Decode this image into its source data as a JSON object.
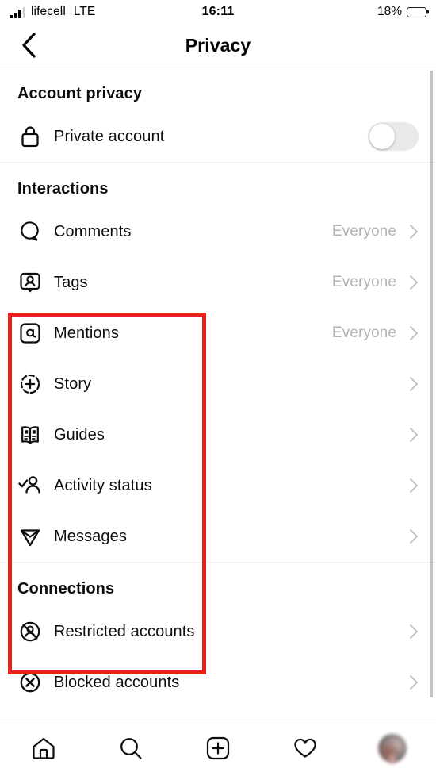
{
  "statusbar": {
    "signal_icon": "cellular-bars-icon",
    "carrier": "lifecell",
    "network": "LTE",
    "time": "16:11",
    "battery_percent": "18%",
    "battery_level": 18,
    "battery_color": "#ff2d22"
  },
  "navbar": {
    "back_icon": "chevron-left-icon",
    "title": "Privacy"
  },
  "sections": [
    {
      "title": "Account privacy",
      "rows": [
        {
          "icon": "lock-icon",
          "label": "Private account",
          "control": "toggle",
          "toggle_on": false
        }
      ]
    },
    {
      "title": "Interactions",
      "rows": [
        {
          "icon": "comment-bubble-icon",
          "label": "Comments",
          "value": "Everyone",
          "control": "chevron"
        },
        {
          "icon": "tag-person-icon",
          "label": "Tags",
          "value": "Everyone",
          "control": "chevron"
        },
        {
          "icon": "mention-at-icon",
          "label": "Mentions",
          "value": "Everyone",
          "control": "chevron"
        },
        {
          "icon": "story-plus-icon",
          "label": "Story",
          "value": "",
          "control": "chevron"
        },
        {
          "icon": "guides-book-icon",
          "label": "Guides",
          "value": "",
          "control": "chevron"
        },
        {
          "icon": "activity-status-icon",
          "label": "Activity status",
          "value": "",
          "control": "chevron"
        },
        {
          "icon": "messages-send-icon",
          "label": "Messages",
          "value": "",
          "control": "chevron"
        }
      ]
    },
    {
      "title": "Connections",
      "rows": [
        {
          "icon": "restricted-account-icon",
          "label": "Restricted accounts",
          "value": "",
          "control": "chevron"
        },
        {
          "icon": "blocked-account-icon",
          "label": "Blocked accounts",
          "value": "",
          "control": "chevron"
        }
      ]
    }
  ],
  "annotation": {
    "type": "highlight-box",
    "color": "#e8211c"
  },
  "tabbar": {
    "items": [
      {
        "icon": "home-icon",
        "label": "Home"
      },
      {
        "icon": "search-icon",
        "label": "Search"
      },
      {
        "icon": "add-post-icon",
        "label": "Create"
      },
      {
        "icon": "heart-activity-icon",
        "label": "Activity"
      },
      {
        "icon": "profile-avatar-icon",
        "label": "Profile"
      }
    ]
  },
  "scrollbar": {
    "name": "vertical-scrollbar"
  }
}
